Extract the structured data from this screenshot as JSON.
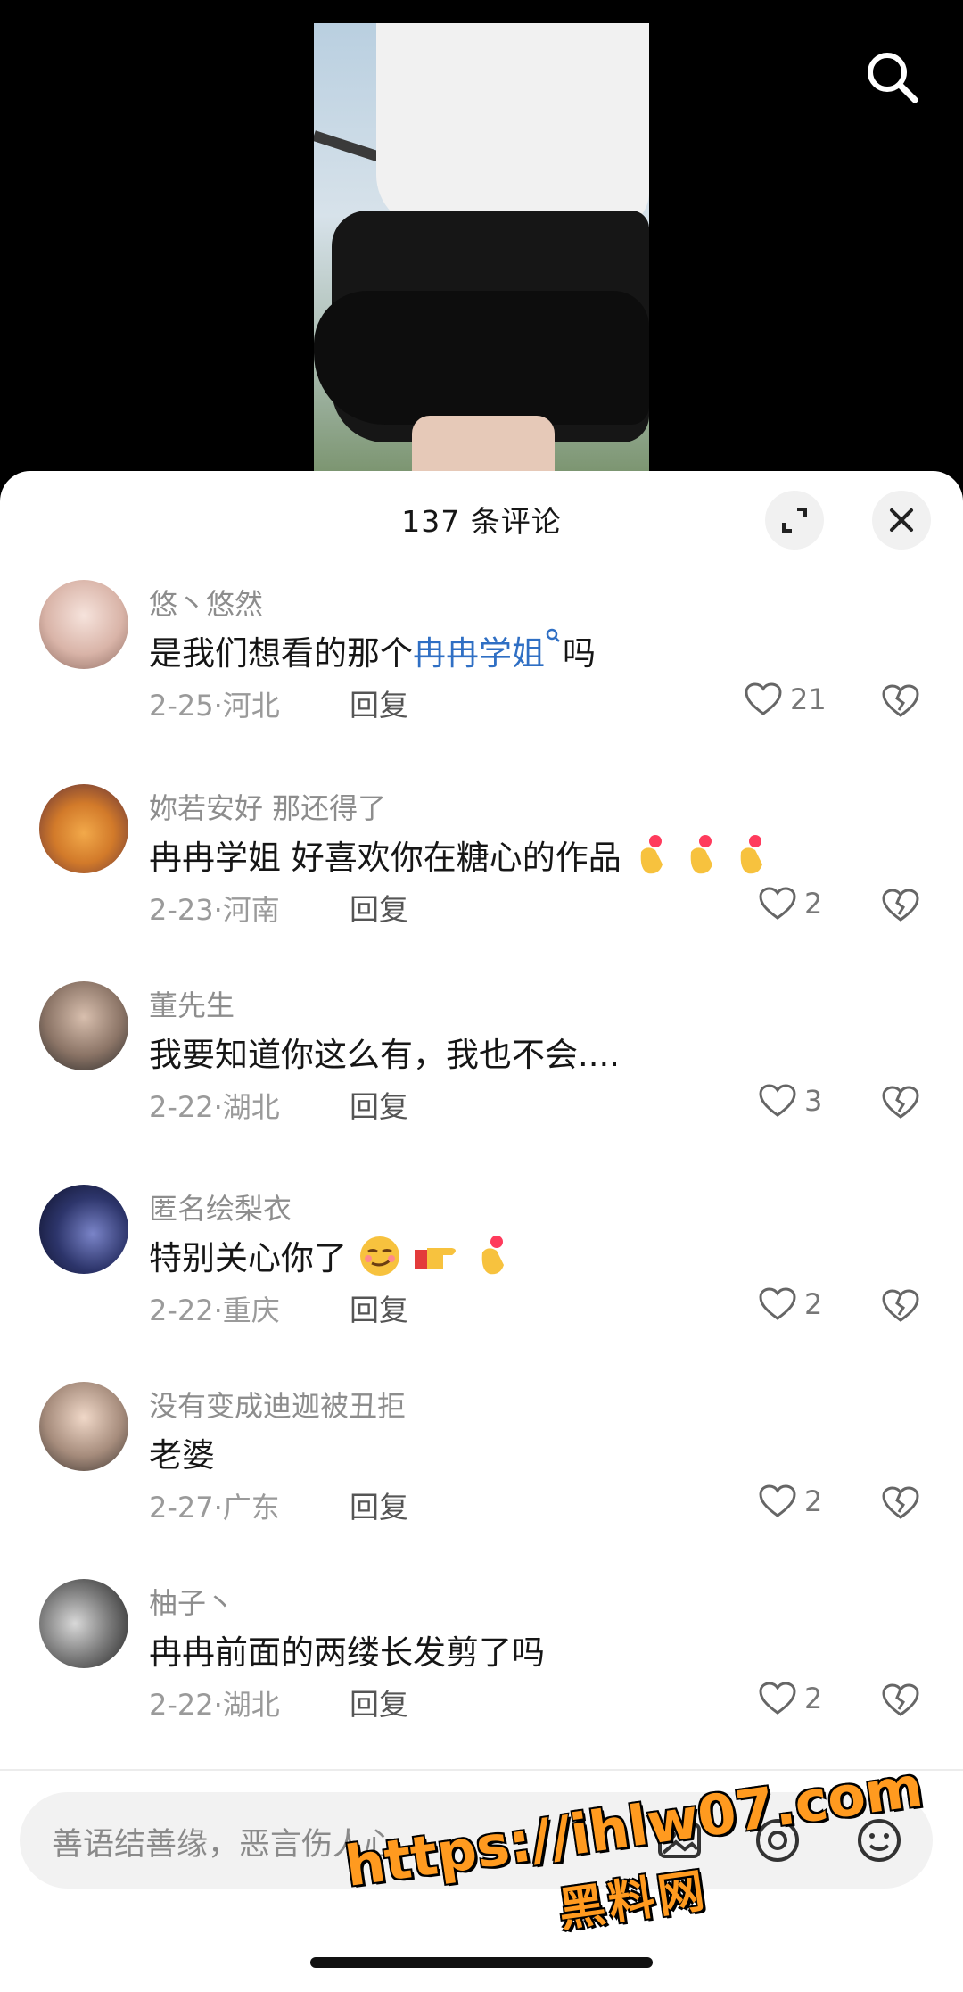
{
  "header": {
    "title": "137 条评论"
  },
  "input": {
    "placeholder": "善语结善缘，恶言伤人心"
  },
  "watermark": {
    "url": "https://ihlw07.com",
    "name": "黑料网"
  },
  "colors": {
    "link": "#2f6fc4",
    "watermark": "#ff9a1f"
  },
  "comments": [
    {
      "user": "悠丶悠然",
      "text_before": "是我们想看的那个",
      "link": "冉冉学姐",
      "text_after": "吗",
      "date": "2-25",
      "region": "河北",
      "reply": "回复",
      "likes": "21"
    },
    {
      "user": "妳若安好  那还得了",
      "text": "冉冉学姐 好喜欢你在糖心的作品",
      "emojis": "finger-heart x3",
      "date": "2-23",
      "region": "河南",
      "reply": "回复",
      "likes": "2"
    },
    {
      "user": "董先生",
      "text": "我要知道你这么有，我也不会....",
      "date": "2-22",
      "region": "湖北",
      "reply": "回复",
      "likes": "3"
    },
    {
      "user": "匿名绘梨衣",
      "text": "特别关心你了",
      "emojis": "smirk, pointing, finger-heart",
      "date": "2-22",
      "region": "重庆",
      "reply": "回复",
      "likes": "2"
    },
    {
      "user": "没有变成迪迦被丑拒",
      "text": "老婆",
      "date": "2-27",
      "region": "广东",
      "reply": "回复",
      "likes": "2"
    },
    {
      "user": "柚子丶",
      "text": "冉冉前面的两缕长发剪了吗",
      "date": "2-22",
      "region": "湖北",
      "reply": "回复",
      "likes": "2"
    }
  ],
  "icons": [
    "search-icon",
    "expand-icon",
    "close-icon",
    "heart-icon",
    "broken-heart-icon",
    "image-icon",
    "at-icon",
    "emoji-icon"
  ]
}
